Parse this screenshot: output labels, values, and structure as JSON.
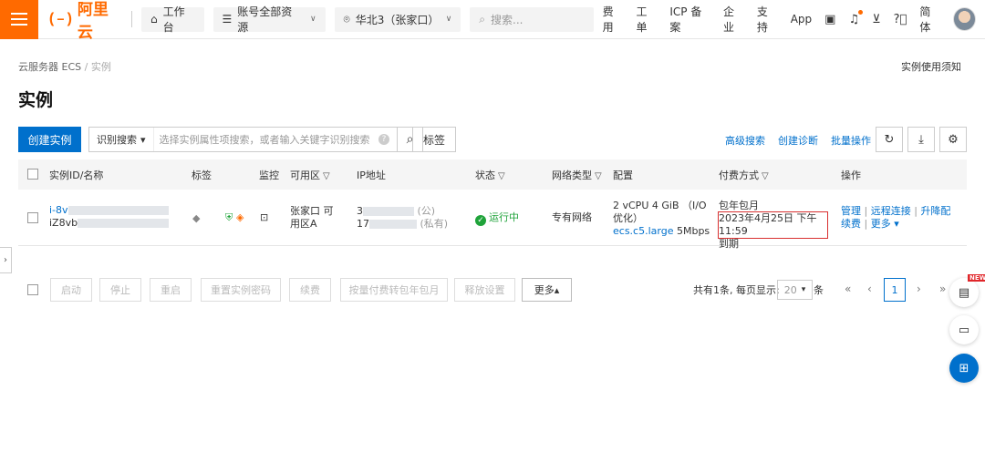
{
  "topbar": {
    "logo_text": "阿里云",
    "workbench": "工作台",
    "resource_scope": "账号全部资源",
    "region": "华北3（张家口）",
    "search_placeholder": "搜索...",
    "nav": [
      "费用",
      "工单",
      "ICP 备案",
      "企业",
      "支持",
      "App"
    ],
    "language": "简体"
  },
  "breadcrumb": {
    "parent": "云服务器 ECS",
    "sep": "/",
    "current": "实例"
  },
  "notice_link": "实例使用须知",
  "page_title": "实例",
  "toolbar": {
    "create": "创建实例",
    "search_type": "识别搜索",
    "search_placeholder": "选择实例属性项搜索，或者输入关键字识别搜索",
    "tag": "标签",
    "links": [
      "高级搜索",
      "创建诊断",
      "批量操作"
    ]
  },
  "table": {
    "columns": [
      "实例ID/名称",
      "标签",
      "监控",
      "可用区",
      "IP地址",
      "状态",
      "网络类型",
      "配置",
      "付费方式",
      "操作"
    ],
    "rows": [
      {
        "id_prefix": "i-8v",
        "name_prefix": "iZ8vb",
        "zone": "张家口 可用区A",
        "ip_public_prefix": "3",
        "ip_public_tag": "(公)",
        "ip_private_prefix": "17",
        "ip_private_tag": "(私有)",
        "status": "运行中",
        "network": "专有网络",
        "config_line1": "2 vCPU 4 GiB （I/O优化）",
        "config_type": "ecs.c5.large",
        "config_bw": "5Mbps",
        "billing": "包年包月",
        "expire": "2023年4月25日 下午11:59",
        "expire_suffix": "到期",
        "actions": [
          "管理",
          "远程连接",
          "升降配",
          "续费",
          "更多"
        ]
      }
    ]
  },
  "bulk_actions": [
    "启动",
    "停止",
    "重启",
    "重置实例密码",
    "续费",
    "按量付费转包年包月",
    "释放设置",
    "更多"
  ],
  "pagination": {
    "summary": "共有1条, 每页显示:",
    "page_size": "20",
    "unit": "条",
    "current_page": "1"
  },
  "float_badge": "NEW",
  "colors": {
    "accent": "#ff6a00",
    "primary": "#0070cc",
    "running": "#1fa33a",
    "highlight_box": "#d93030"
  }
}
